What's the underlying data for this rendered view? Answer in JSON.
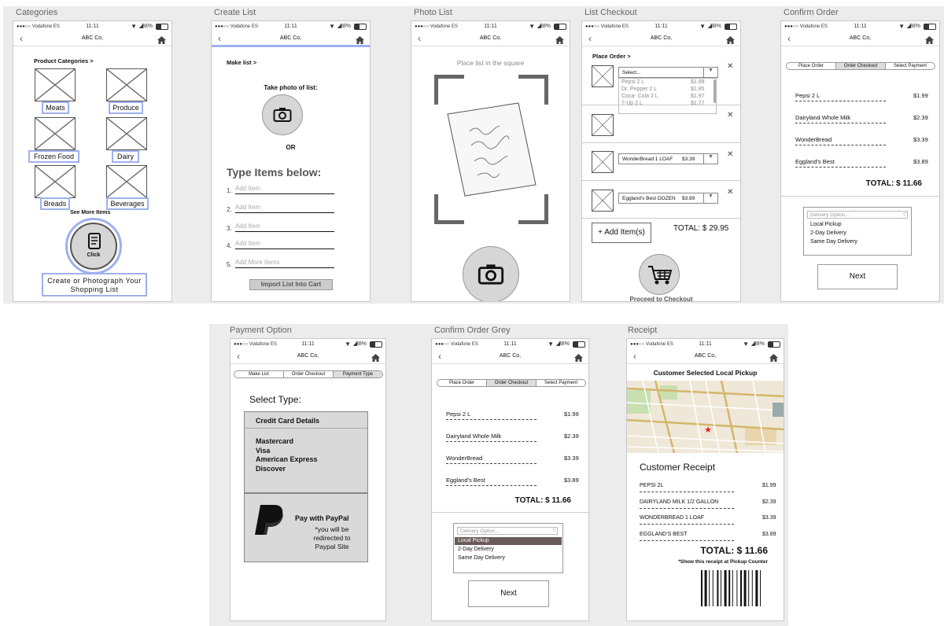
{
  "colors": {
    "accent": "#9fb0ee",
    "panel_gray": "#d9d9d9",
    "highlight": "#6b5a5a"
  },
  "statusbar": {
    "carrier": "●●●○○ Vodafone ES",
    "time": "11:11",
    "battery": "38%"
  },
  "nav_title": "ABC Co,",
  "boards": {
    "categories": {
      "title": "Categories",
      "heading": "Product Categories",
      "items": [
        "Meats",
        "Produce",
        "Frozen Food",
        "Dairy",
        "Breads",
        "Beverages"
      ],
      "see_more": "See More Items",
      "click": "Click",
      "cta": "Create or Photograph Your Shopping List"
    },
    "create_list": {
      "title": "Create List",
      "make_list": "Make list",
      "take_photo": "Take photo of list:",
      "or": "OR",
      "type_items": "Type Items below:",
      "add_item": "Add Item",
      "add_more": "Add More Items",
      "nums": [
        "1.",
        "2.",
        "3.",
        "4.",
        "5."
      ],
      "import_btn": "Import List Into Cart"
    },
    "photo_list": {
      "title": "Photo List",
      "instruction": "Place list in the square"
    },
    "list_checkout": {
      "title": "List Checkout",
      "place_order": "Place Order",
      "select": "Select...",
      "options": [
        {
          "name": "Pepsi  2 L",
          "price": "$1.99"
        },
        {
          "name": "Dr. Pepper  2 L",
          "price": "$1.85"
        },
        {
          "name": "Coca- Cola  2 L",
          "price": "$1.97"
        },
        {
          "name": "7-Up 2 L",
          "price": "$1.77"
        }
      ],
      "row2_name": "WonderBread 1 LOAF",
      "row2_price": "$3.39",
      "row3_name": "Eggland's Best DOZEN",
      "row3_price": "$3.89",
      "add_items": "+ Add Item(s)",
      "total": "TOTAL: $ 29.95",
      "proceed": "Proceed to Checkout"
    },
    "confirm_order": {
      "title": "Confirm Order",
      "tabs": [
        "Place Order",
        "Order Checkout",
        "Select Payment"
      ],
      "items": [
        {
          "name": "Pepsi 2 L",
          "price": "$1.99"
        },
        {
          "name": "Dairyland Whole Milk",
          "price": "$2.39"
        },
        {
          "name": "WonderBread",
          "price": "$3.39"
        },
        {
          "name": "Eggland's Best",
          "price": "$3.89"
        }
      ],
      "total": "TOTAL: $ 11.66",
      "delivery_placeholder": "Delivery Option...",
      "delivery_options": [
        "Local Pickup",
        "2-Day Delivery",
        "Same Day Delivery"
      ],
      "next": "Next"
    },
    "payment_option": {
      "title": "Payment Option",
      "tabs": [
        "Make List",
        "Order Checkout",
        "Payment Type"
      ],
      "select_type": "Select Type:",
      "cc_details": "Credit Card Details",
      "cards": [
        "Mastercard",
        "Visa",
        "American Express",
        "Discover"
      ],
      "paypal": "Pay with PayPal",
      "paypal_note": "*you will be redirected to Paypal Site"
    },
    "confirm_grey": {
      "title": "Confirm Order Grey",
      "tabs": [
        "Place Order",
        "Order Checkout",
        "Select Payment"
      ],
      "items": [
        {
          "name": "Pepsi 2 L",
          "price": "$1.99"
        },
        {
          "name": "Dairyland Whole Milk",
          "price": "$2.39"
        },
        {
          "name": "WonderBread",
          "price": "$3.39"
        },
        {
          "name": "Eggland's Best",
          "price": "$3.89"
        }
      ],
      "total": "TOTAL: $ 11.66",
      "delivery_placeholder": "Delivery Option...",
      "delivery_options": [
        "Local Pickup",
        "2-Day Delivery",
        "Same Day Delivery"
      ],
      "next": "Next"
    },
    "receipt": {
      "title": "Receipt",
      "header": "Customer Selected Local Pickup",
      "heading": "Customer Receipt",
      "items": [
        {
          "name": "PEPSI 2L",
          "price": "$1.99"
        },
        {
          "name": "DAIRYLAND MILK 1/2 GALLON",
          "price": "$2.39"
        },
        {
          "name": "WONDERBREAD 1 LOAF",
          "price": "$3.39"
        },
        {
          "name": "EGGLAND'S BEST",
          "price": "$3.89"
        }
      ],
      "total": "TOTAL: $ 11.66",
      "note": "*Show this receipt at Pickup Counter"
    }
  }
}
